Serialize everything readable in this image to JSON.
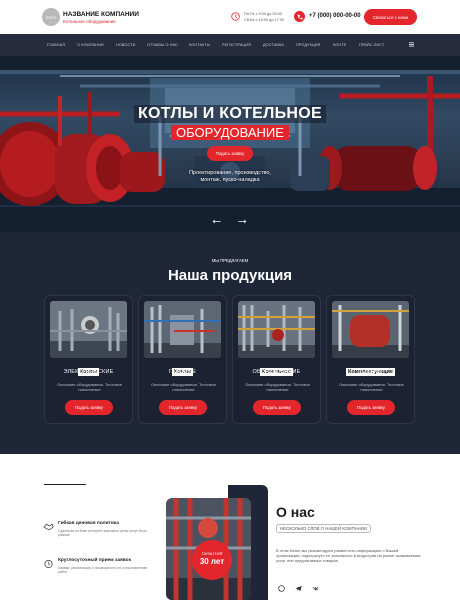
{
  "header": {
    "logo_text": "ЛОГО",
    "company_name": "НАЗВАНИЕ КОМПАНИИ",
    "company_subtitle": "Котельное оборудование",
    "hours_line1": "Пн-Пт с 9:00 до 20:00",
    "hours_line2": "Сб-Вс с 10:00 до 17:00",
    "phone": "+7 (000) 000-00-00",
    "callback_label": "Связаться с нами"
  },
  "nav": {
    "items": [
      "ГЛАВНАЯ",
      "О КОМПАНИИ",
      "НОВОСТИ",
      "ОТЗЫВЫ О НАС",
      "КОНТАКТЫ",
      "РЕГИСТРАЦИЯ",
      "ДОСТАВКА",
      "ПРОДУКЦИЯ",
      "КОНТЕ",
      "ПРАЙС-ЛИСТ"
    ]
  },
  "hero": {
    "title_line1": "КОТЛЫ И КОТЕЛЬНОЕ",
    "title_line2": "ОБОРУДОВАНИЕ",
    "button_label": "Подать заявку",
    "tagline": "Проектирование, производство, монтаж, пуско-наладка"
  },
  "products": {
    "kicker": "МЫ ПРЕДЛАГАЕМ",
    "title": "Наша продукция",
    "cards": [
      {
        "badge": "Котлы",
        "title": "ЭЛЕКТРИЧЕСКИЕ",
        "desc": "Описание оборудования. Тестовое наполнение",
        "button": "Подать заявку"
      },
      {
        "badge": "Котлы",
        "title": "ГАЗОВЫЕ",
        "desc": "Описание оборудования. Тестовое наполнение",
        "button": "Подать заявку"
      },
      {
        "badge": "Котельное",
        "title": "ОБОРУДОВАНИЕ",
        "desc": "Описание оборудования. Тестовое наполнение",
        "button": "Подать заявку"
      },
      {
        "badge": "Комплектующие",
        "title": "ТОВАРЫ",
        "desc": "Описание оборудования. Тестовое наполнение",
        "button": "Подать заявку"
      }
    ]
  },
  "about": {
    "features": [
      {
        "title": "Гибкая ценовая политика",
        "desc": "Сдельная на базе интернет-магазина цены могут быть разные"
      },
      {
        "title": "Круглосуточный прием заявок",
        "desc": "Заявки, реализация, и возможность по сопоставлению работ"
      }
    ],
    "guarantee_label": "ГАРАНТИЯ",
    "guarantee_value": "30 лет",
    "title": "О нас",
    "subtitle": "НЕСКОЛЬКО СЛОВ О НАШЕЙ КОМПАНИИ",
    "text": "В этом блоке мы рекомендуем разместить информацию о Вашей организации, подчеркнуть ее значимость в индустрии на рынке оказываемых услуг или предлагаемых товаров."
  },
  "colors": {
    "accent": "#e3262b",
    "dark": "#1f2637",
    "nav": "#262c3e"
  }
}
